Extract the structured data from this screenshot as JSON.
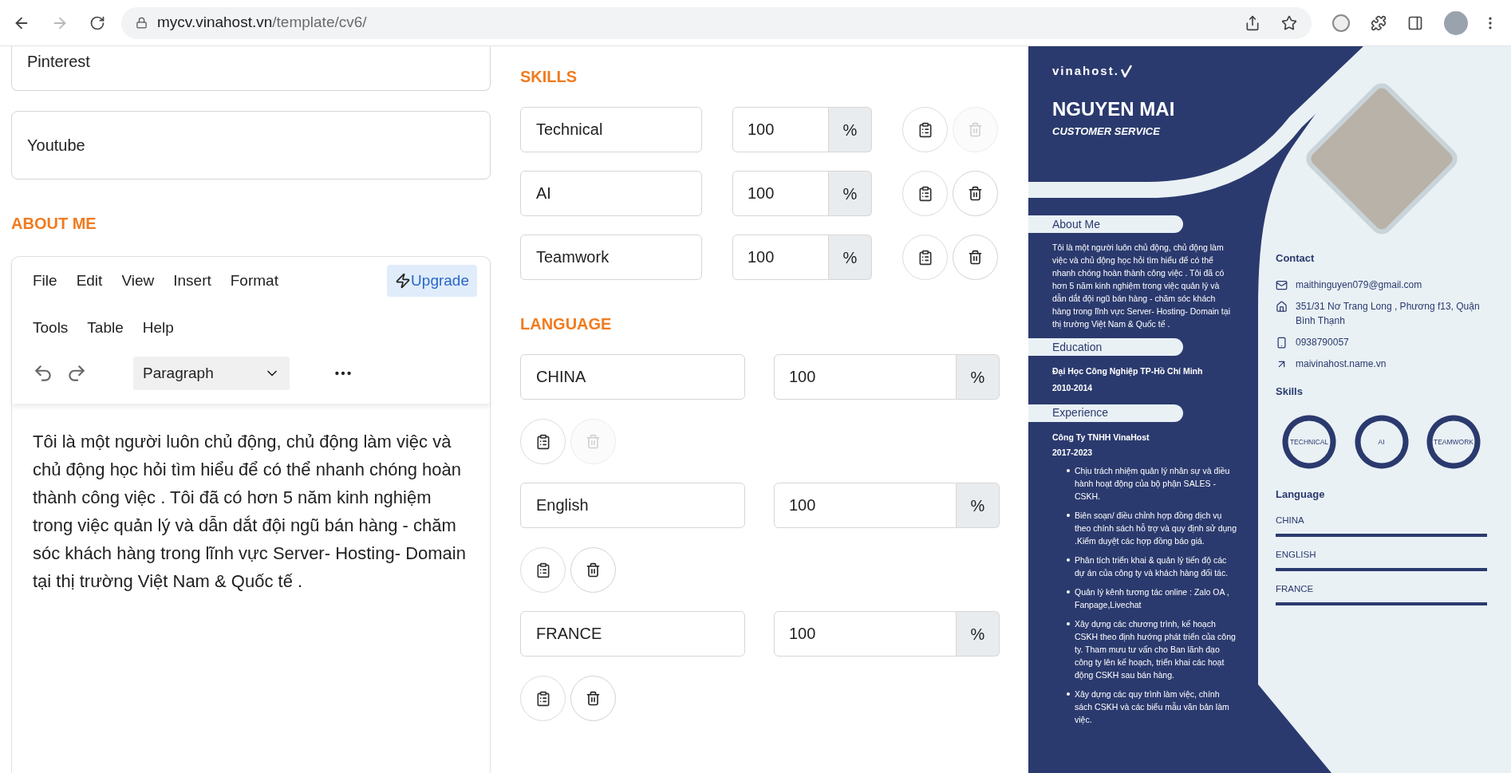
{
  "browser": {
    "url_host": "mycv.vinahost.vn",
    "url_path": "/template/cv6/"
  },
  "social_fields": [
    {
      "value": "Pinterest"
    },
    {
      "value": "Youtube"
    }
  ],
  "about": {
    "heading": "ABOUT ME",
    "menu": [
      "File",
      "Edit",
      "View",
      "Insert",
      "Format"
    ],
    "upgrade": "Upgrade",
    "menu_row2": [
      "Tools",
      "Table",
      "Help"
    ],
    "block_format": "Paragraph",
    "content": "Tôi là một người luôn chủ động, chủ động làm việc và chủ động học hỏi tìm hiểu để có thể nhanh chóng hoàn thành công việc . Tôi đã có hơn 5 năm kinh nghiệm trong việc quản lý và dẫn dắt đội ngũ bán hàng - chăm sóc khách hàng trong lĩnh vực Server- Hosting- Domain tại thị trường Việt Nam & Quốc tế ."
  },
  "skills": {
    "heading": "SKILLS",
    "rows": [
      {
        "name": "Technical",
        "value": "100",
        "unit": "%",
        "delete_disabled": true
      },
      {
        "name": "AI",
        "value": "100",
        "unit": "%",
        "delete_disabled": false
      },
      {
        "name": "Teamwork",
        "value": "100",
        "unit": "%",
        "delete_disabled": false
      }
    ]
  },
  "language": {
    "heading": "LANGUAGE",
    "rows": [
      {
        "name": "CHINA",
        "value": "100",
        "unit": "%",
        "delete_disabled": true
      },
      {
        "name": "English",
        "value": "100",
        "unit": "%",
        "delete_disabled": false
      },
      {
        "name": "FRANCE",
        "value": "100",
        "unit": "%",
        "delete_disabled": false
      }
    ]
  },
  "cv": {
    "logo": "vinahost.",
    "name": "NGUYEN MAI",
    "role": "CUSTOMER SERVICE",
    "about": {
      "heading": "About Me",
      "text": "Tôi là một người luôn chủ động, chủ động làm việc và chủ động học hỏi tìm hiểu để có thể nhanh chóng hoàn thành công việc . Tôi đã có hơn 5 năm kinh nghiệm trong việc quản lý và dẫn dắt đội ngũ bán hàng - chăm sóc khách hàng trong lĩnh vực Server- Hosting- Domain tại thị trường Việt Nam & Quốc tế ."
    },
    "education": {
      "heading": "Education",
      "school": "Đại Học Công Nghiệp TP-Hồ Chí Minh",
      "years": "2010-2014"
    },
    "experience": {
      "heading": "Experience",
      "company": "Công Ty TNHH VinaHost",
      "years": "2017-2023",
      "duties": [
        "Chịu trách nhiệm quản lý nhân sự và điều hành hoạt động của bộ phận SALES - CSKH.",
        "Biên soạn/ điều chỉnh hợp đồng dịch vụ theo chính sách hỗ trợ và quy định sử dụng .Kiểm duyệt các hợp đồng báo giá.",
        "Phân tích triển khai & quản lý tiến độ các dự án của công ty và khách hàng đối tác.",
        "Quản lý kênh tương tác online : Zalo OA , Fanpage,Livechat",
        "Xây dựng các chương trình, kế hoạch CSKH theo định hướng phát triển của công ty. Tham mưu tư vấn cho Ban lãnh đạo công ty lên kế hoạch, triển khai các hoạt động CSKH sau bán hàng.",
        "Xây dựng các quy trình làm việc, chính sách CSKH và các biểu mẫu văn bản làm việc."
      ]
    },
    "contact": {
      "heading": "Contact",
      "items": [
        {
          "kind": "email",
          "text": "maithinguyen079@gmail.com"
        },
        {
          "kind": "address",
          "text": "351/31 Nơ Trang Long , Phương f13, Quận Bình Thạnh"
        },
        {
          "kind": "phone",
          "text": "0938790057"
        },
        {
          "kind": "web",
          "text": "maivinahost.name.vn"
        }
      ]
    },
    "skills": {
      "heading": "Skills",
      "items": [
        {
          "label": "TECHNICAL",
          "level": 1
        },
        {
          "label": "AI",
          "level": 1
        },
        {
          "label": "TEAMWORK",
          "level": 1
        }
      ]
    },
    "languages": {
      "heading": "Language",
      "items": [
        {
          "label": "CHINA",
          "level": 1
        },
        {
          "label": "ENGLISH",
          "level": 1
        },
        {
          "label": "FRANCE",
          "level": 1
        }
      ]
    }
  }
}
